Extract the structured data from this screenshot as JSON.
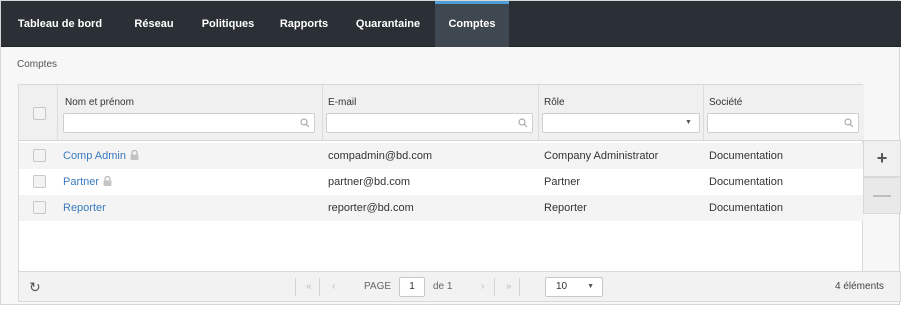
{
  "nav": {
    "tabs": [
      {
        "label": "Tableau de bord",
        "active": false
      },
      {
        "label": "Réseau",
        "active": false
      },
      {
        "label": "Politiques",
        "active": false
      },
      {
        "label": "Rapports",
        "active": false
      },
      {
        "label": "Quarantaine",
        "active": false
      },
      {
        "label": "Comptes",
        "active": true
      }
    ]
  },
  "breadcrumb": "Comptes",
  "table": {
    "columns": [
      {
        "title": "Nom et prénom",
        "filter_type": "text",
        "filter_icon": "search-icon"
      },
      {
        "title": "E-mail",
        "filter_type": "text",
        "filter_icon": "search-icon"
      },
      {
        "title": "Rôle",
        "filter_type": "select",
        "filter_icon": "chevron-down-icon"
      },
      {
        "title": "Société",
        "filter_type": "text",
        "filter_icon": "search-icon"
      }
    ],
    "rows": [
      {
        "name": "Comp Admin",
        "locked": true,
        "email": "compadmin@bd.com",
        "role": "Company Administrator",
        "company": "Documentation"
      },
      {
        "name": "Partner",
        "locked": true,
        "email": "partner@bd.com",
        "role": "Partner",
        "company": "Documentation"
      },
      {
        "name": "Reporter",
        "locked": false,
        "email": "reporter@bd.com",
        "role": "Reporter",
        "company": "Documentation"
      }
    ]
  },
  "actions": {
    "add_label": "+",
    "remove_label": "—"
  },
  "pager": {
    "refresh_icon": "refresh-icon",
    "first_icon": "«",
    "prev_icon": "‹",
    "page_label": "PAGE",
    "page_value": "1",
    "of_label": "de 1",
    "next_icon": "›",
    "last_icon": "»",
    "page_size": "10",
    "total": "4 éléments"
  },
  "colors": {
    "nav_bg": "#2b3036",
    "nav_active_bg": "#3f4750",
    "nav_active_accent": "#4e9fd8",
    "link": "#3a7bbf"
  }
}
